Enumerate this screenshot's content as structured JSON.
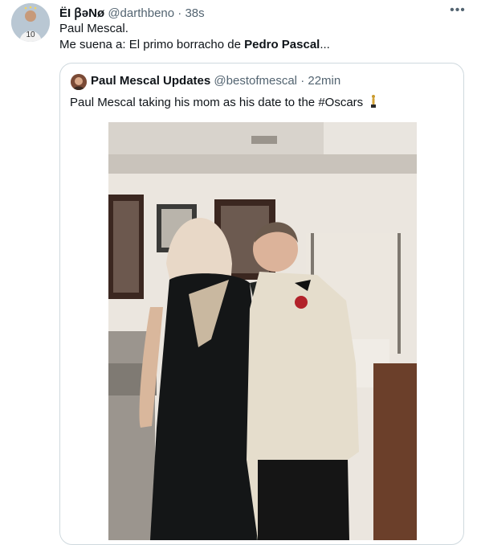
{
  "tweet": {
    "author_name": "ËI ꞵəNø",
    "handle": "@darthbeno",
    "time": "38s",
    "more_icon": "more-icon",
    "line1": "Paul Mescal.",
    "line2_prefix": "Me suena a: El primo borracho de ",
    "line2_bold": "Pedro Pascal",
    "line2_suffix": "..."
  },
  "quote": {
    "author_name": "Paul Mescal Updates",
    "handle": "@bestofmescal",
    "separator": "·",
    "time": "22min",
    "text": "Paul Mescal taking his mom as his date to the #Oscars",
    "emoji_icon": "oscar-statue-icon"
  },
  "colors": {
    "text": "#0f1419",
    "muted": "#536471",
    "border": "#cfd9de"
  }
}
